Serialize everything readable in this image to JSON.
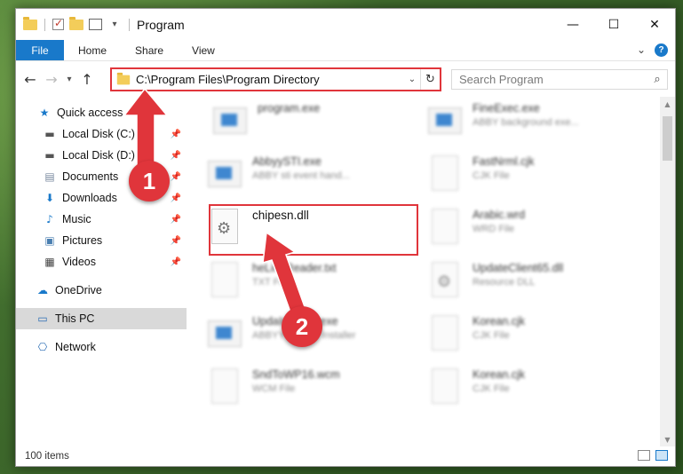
{
  "window": {
    "title": "Program",
    "controls": {
      "minimize": "—",
      "maximize": "☐",
      "close": "✕"
    }
  },
  "ribbon": {
    "tabs": [
      "File",
      "Home",
      "Share",
      "View"
    ],
    "expand_icon": "⌄",
    "help_label": "?"
  },
  "address_bar": {
    "path": "C:\\Program Files\\Program Directory"
  },
  "search": {
    "placeholder": "Search Program"
  },
  "nav_pane": {
    "quick_access": "Quick access",
    "items": [
      {
        "label": "Local Disk (C:)",
        "icon": "drive-icon"
      },
      {
        "label": "Local Disk (D:)",
        "icon": "drive-icon"
      },
      {
        "label": "Documents",
        "icon": "documents-icon"
      },
      {
        "label": "Downloads",
        "icon": "downloads-icon"
      },
      {
        "label": "Music",
        "icon": "music-icon"
      },
      {
        "label": "Pictures",
        "icon": "pictures-icon"
      },
      {
        "label": "Videos",
        "icon": "videos-icon"
      }
    ],
    "onedrive": "OneDrive",
    "this_pc": "This PC",
    "network": "Network"
  },
  "files": {
    "left": [
      {
        "name": "program.exe",
        "type": ""
      },
      {
        "name": "AbbyySTI.exe",
        "type": "ABBY sti event hand..."
      },
      {
        "name": "chipesn.dll",
        "type": ""
      },
      {
        "name": "heLineReader.txt",
        "type": "TXT File"
      },
      {
        "name": "UpdaInstaller.exe",
        "type": "ABBYY Update Installer"
      },
      {
        "name": "SndToWP16.wcm",
        "type": "WCM File"
      }
    ],
    "right": [
      {
        "name": "FineExec.exe",
        "type": "ABBY background exe..."
      },
      {
        "name": "FastNrml.cjk",
        "type": "CJK File"
      },
      {
        "name": "Arabic.wrd",
        "type": "WRD File"
      },
      {
        "name": "UpdateClient65.dll",
        "type": "Resource DLL"
      },
      {
        "name": "Korean.cjk",
        "type": "CJK File"
      },
      {
        "name": "Korean.cjk",
        "type": "CJK File"
      }
    ]
  },
  "status": {
    "item_count": "100 items"
  },
  "annotations": {
    "step1": "1",
    "step2": "2",
    "color": "#e0353b"
  }
}
